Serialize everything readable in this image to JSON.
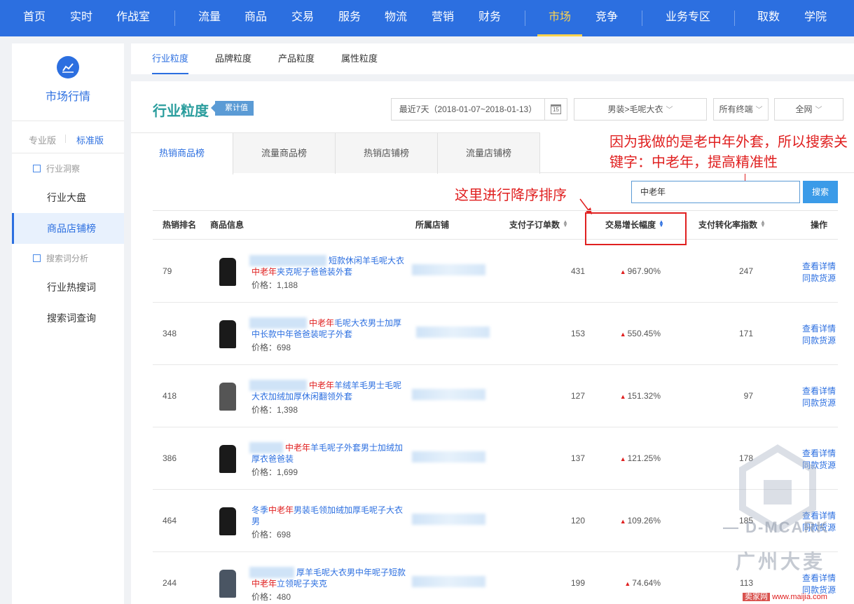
{
  "topnav": {
    "items": [
      "首页",
      "实时",
      "作战室",
      "流量",
      "商品",
      "交易",
      "服务",
      "物流",
      "营销",
      "财务",
      "市场",
      "竞争",
      "业务专区",
      "取数",
      "学院"
    ],
    "active": "市场"
  },
  "sidebar": {
    "title": "市场行情",
    "version_pro": "专业版",
    "version_std": "标准版",
    "group1": "行业洞察",
    "item_dashboard": "行业大盘",
    "item_shop_rank": "商品店铺榜",
    "group2": "搜索词分析",
    "item_hot_words": "行业热搜词",
    "item_word_query": "搜索词查询"
  },
  "subtabs": [
    "行业粒度",
    "品牌粒度",
    "产品粒度",
    "属性粒度"
  ],
  "header": {
    "title": "行业粒度",
    "badge": "累计值",
    "date_range": "最近7天（2018-01-07~2018-01-13）",
    "category": "男装>毛呢大衣",
    "terminal": "所有终端",
    "network": "全网"
  },
  "rank_tabs": [
    "热销商品榜",
    "流量商品榜",
    "热销店铺榜",
    "流量店铺榜"
  ],
  "annotations": {
    "keyword_note": "因为我做的是老中年外套，所以搜索关键字：中老年，提高精准性",
    "sort_note": "这里进行降序排序"
  },
  "search": {
    "value": "中老年",
    "button": "搜索"
  },
  "table": {
    "headers": {
      "rank": "热销排名",
      "product": "商品信息",
      "shop": "所属店铺",
      "orders": "支付子订单数",
      "growth": "交易增长幅度",
      "conversion": "支付转化率指数",
      "ops": "操作"
    },
    "op_detail": "查看详情",
    "op_same": "同款货源",
    "rows": [
      {
        "rank": "79",
        "pre": "短款休闲羊毛呢大衣",
        "kw": "中老年",
        "post": "夹克呢子爸爸装外套",
        "price": "价格：1,188",
        "orders": "431",
        "growth": "967.90%",
        "conv": "247",
        "kwFirst": false
      },
      {
        "rank": "348",
        "pre": "",
        "kw": "中老年",
        "post": "毛呢大衣男士加厚中长款中年爸爸装呢子外套",
        "price": "价格：698",
        "orders": "153",
        "growth": "550.45%",
        "conv": "171",
        "kwFirst": true
      },
      {
        "rank": "418",
        "pre": "",
        "kw": "中老年",
        "post": "羊绒羊毛男士毛呢大衣加绒加厚休闲翻领外套",
        "price": "价格：1,398",
        "orders": "127",
        "growth": "151.32%",
        "conv": "97",
        "kwFirst": true
      },
      {
        "rank": "386",
        "pre": "",
        "kw": "中老年",
        "post": "羊毛呢子外套男士加绒加厚衣爸爸装",
        "price": "价格：1,699",
        "orders": "137",
        "growth": "121.25%",
        "conv": "178",
        "kwFirst": true
      },
      {
        "rank": "464",
        "pre": "冬季",
        "kw": "中老年",
        "post": "男装毛领加绒加厚毛呢子大衣男",
        "price": "价格：698",
        "orders": "120",
        "growth": "109.26%",
        "conv": "185",
        "kwFirst": false
      },
      {
        "rank": "244",
        "pre": "厚羊毛呢大衣男中年呢子短款",
        "kw": "中老年",
        "post": "立领呢子夹克",
        "price": "价格：480",
        "orders": "199",
        "growth": "74.64%",
        "conv": "113",
        "kwFirst": false
      }
    ]
  },
  "watermark": {
    "line1": "— D-MCARK",
    "line2": "广州大麦"
  },
  "footer": {
    "site_badge": "卖家网",
    "url": "www.maijia.com"
  },
  "colors": {
    "nav": "#2c6fe0",
    "accent": "#2c6fe0",
    "annotation": "#e02020",
    "title": "#2a9d9d"
  }
}
